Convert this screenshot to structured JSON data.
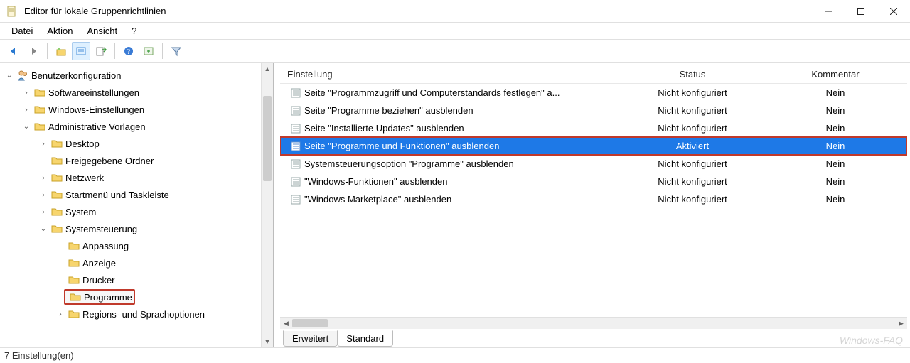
{
  "window": {
    "title": "Editor für lokale Gruppenrichtlinien"
  },
  "menu": {
    "file": "Datei",
    "action": "Aktion",
    "view": "Ansicht",
    "help": "?"
  },
  "tree": {
    "root": "Benutzerkonfiguration",
    "software": "Softwareeinstellungen",
    "windows": "Windows-Einstellungen",
    "templates": "Administrative Vorlagen",
    "desktop": "Desktop",
    "shared": "Freigegebene Ordner",
    "network": "Netzwerk",
    "startmenu": "Startmenü und Taskleiste",
    "system": "System",
    "controlpanel": "Systemsteuerung",
    "customize": "Anpassung",
    "display": "Anzeige",
    "printer": "Drucker",
    "programs": "Programme",
    "region": "Regions- und Sprachoptionen"
  },
  "columns": {
    "setting": "Einstellung",
    "status": "Status",
    "comment": "Kommentar"
  },
  "rows": [
    {
      "name": "Seite \"Programmzugriff und Computerstandards festlegen\" a...",
      "status": "Nicht konfiguriert",
      "comment": "Nein"
    },
    {
      "name": "Seite \"Programme beziehen\" ausblenden",
      "status": "Nicht konfiguriert",
      "comment": "Nein"
    },
    {
      "name": "Seite \"Installierte Updates\" ausblenden",
      "status": "Nicht konfiguriert",
      "comment": "Nein"
    },
    {
      "name": "Seite \"Programme und Funktionen\" ausblenden",
      "status": "Aktiviert",
      "comment": "Nein"
    },
    {
      "name": "Systemsteuerungsoption \"Programme\" ausblenden",
      "status": "Nicht konfiguriert",
      "comment": "Nein"
    },
    {
      "name": "\"Windows-Funktionen\" ausblenden",
      "status": "Nicht konfiguriert",
      "comment": "Nein"
    },
    {
      "name": "\"Windows Marketplace\" ausblenden",
      "status": "Nicht konfiguriert",
      "comment": "Nein"
    }
  ],
  "tabs": {
    "extended": "Erweitert",
    "standard": "Standard"
  },
  "status": "7 Einstellung(en)",
  "watermark": "Windows-FAQ"
}
